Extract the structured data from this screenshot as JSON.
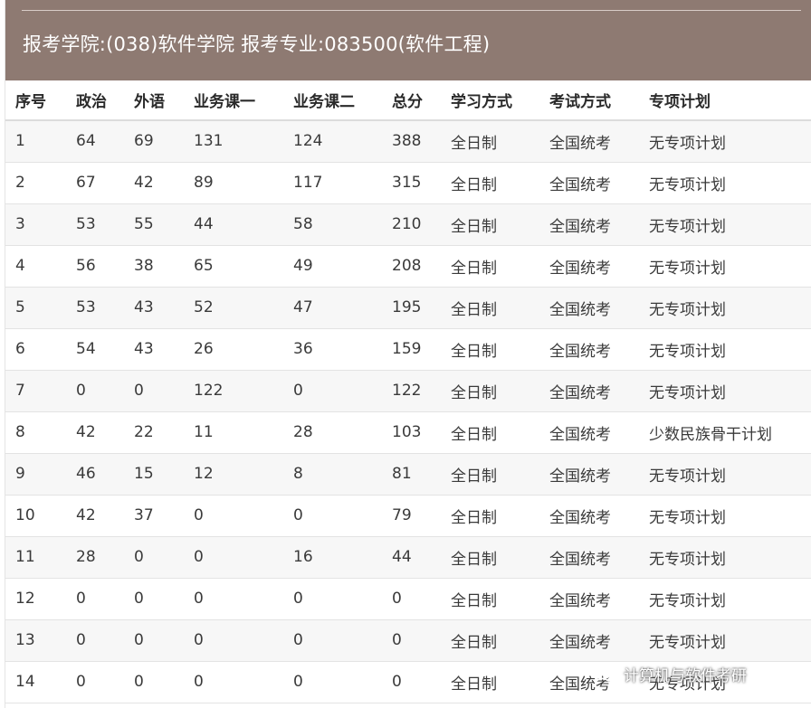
{
  "header": {
    "title": "报考学院:(038)软件学院 报考专业:083500(软件工程)"
  },
  "table": {
    "columns": [
      "序号",
      "政治",
      "外语",
      "业务课一",
      "业务课二",
      "总分",
      "学习方式",
      "考试方式",
      "专项计划"
    ],
    "rows": [
      [
        "1",
        "64",
        "69",
        "131",
        "124",
        "388",
        "全日制",
        "全国统考",
        "无专项计划"
      ],
      [
        "2",
        "67",
        "42",
        "89",
        "117",
        "315",
        "全日制",
        "全国统考",
        "无专项计划"
      ],
      [
        "3",
        "53",
        "55",
        "44",
        "58",
        "210",
        "全日制",
        "全国统考",
        "无专项计划"
      ],
      [
        "4",
        "56",
        "38",
        "65",
        "49",
        "208",
        "全日制",
        "全国统考",
        "无专项计划"
      ],
      [
        "5",
        "53",
        "43",
        "52",
        "47",
        "195",
        "全日制",
        "全国统考",
        "无专项计划"
      ],
      [
        "6",
        "54",
        "43",
        "26",
        "36",
        "159",
        "全日制",
        "全国统考",
        "无专项计划"
      ],
      [
        "7",
        "0",
        "0",
        "122",
        "0",
        "122",
        "全日制",
        "全国统考",
        "无专项计划"
      ],
      [
        "8",
        "42",
        "22",
        "11",
        "28",
        "103",
        "全日制",
        "全国统考",
        "少数民族骨干计划"
      ],
      [
        "9",
        "46",
        "15",
        "12",
        "8",
        "81",
        "全日制",
        "全国统考",
        "无专项计划"
      ],
      [
        "10",
        "42",
        "37",
        "0",
        "0",
        "79",
        "全日制",
        "全国统考",
        "无专项计划"
      ],
      [
        "11",
        "28",
        "0",
        "0",
        "16",
        "44",
        "全日制",
        "全国统考",
        "无专项计划"
      ],
      [
        "12",
        "0",
        "0",
        "0",
        "0",
        "0",
        "全日制",
        "全国统考",
        "无专项计划"
      ],
      [
        "13",
        "0",
        "0",
        "0",
        "0",
        "0",
        "全日制",
        "全国统考",
        "无专项计划"
      ],
      [
        "14",
        "0",
        "0",
        "0",
        "0",
        "0",
        "全日制",
        "全国统考",
        "无专项计划"
      ]
    ]
  },
  "watermark": {
    "text": "计算机与软件考研",
    "icon": "wechat-icon"
  },
  "colors": {
    "header_bg": "#8e7a72",
    "header_text": "#ffffff",
    "row_alt": "#f7f7f7"
  }
}
